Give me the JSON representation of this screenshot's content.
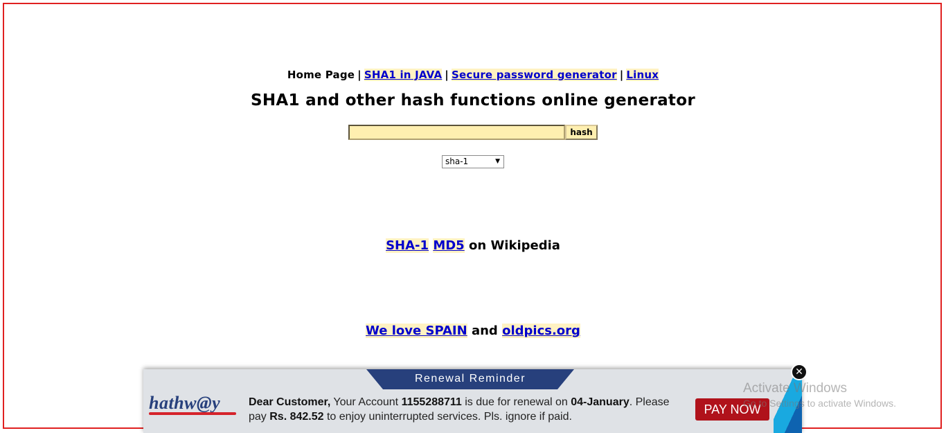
{
  "nav": {
    "home": "Home Page",
    "sep": "|",
    "links": [
      "SHA1 in JAVA",
      "Secure password generator",
      "Linux"
    ]
  },
  "page_title": "SHA1 and other hash functions online generator",
  "hash_form": {
    "input_value": "",
    "button_label": "hash",
    "algorithm_selected": "sha-1"
  },
  "wiki_line": {
    "link1": "SHA-1",
    "link2": "MD5",
    "suffix": "on Wikipedia"
  },
  "spain_line": {
    "link1": "We love SPAIN",
    "middle": "and",
    "link2": "oldpics.org"
  },
  "banner": {
    "tab_title": "Renewal Reminder",
    "logo_text": "hathw@y",
    "msg_greeting": "Dear Customer,",
    "msg_part1": " Your Account ",
    "account_number": "1155288711",
    "msg_part2": " is due for renewal on ",
    "due_date": "04-January",
    "msg_part3": ". Please pay ",
    "amount": "Rs. 842.52",
    "msg_part4": " to enjoy uninterrupted services. Pls. ignore if paid.",
    "pay_button": "PAY NOW",
    "close_glyph": "✕",
    "colors": {
      "banner_blue": "#27407c",
      "pay_red": "#b0121b"
    }
  },
  "watermark": {
    "line1": "Activate Windows",
    "line2": "Go to Settings to activate Windows."
  },
  "icons": {
    "close": "close-icon",
    "dropdown": "chevron-down-icon"
  }
}
